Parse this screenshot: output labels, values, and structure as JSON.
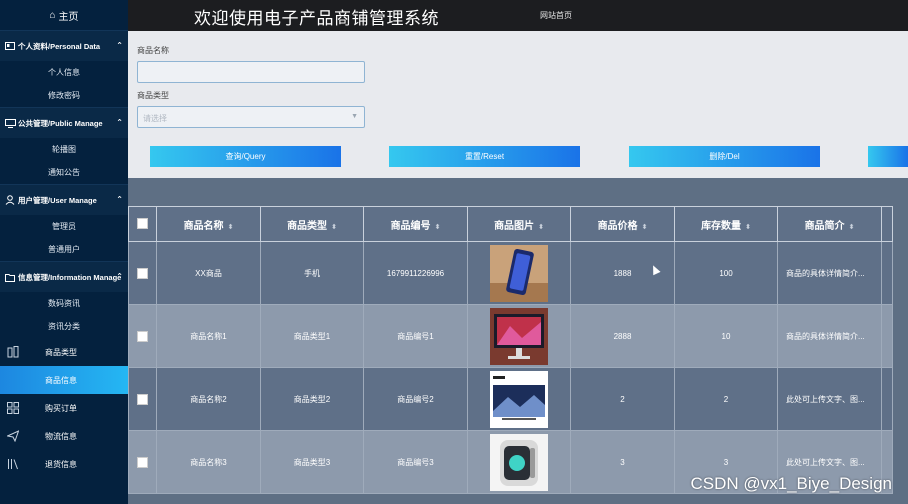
{
  "sidebar": {
    "home": "主页",
    "groups": [
      {
        "label": "个人资料/Personal Data",
        "items": [
          "个人信息",
          "修改密码"
        ]
      },
      {
        "label": "公共管理/Public Manage",
        "items": [
          "轮播图",
          "通知公告"
        ]
      },
      {
        "label": "用户管理/User Manage",
        "items": [
          "管理员",
          "普通用户"
        ]
      },
      {
        "label": "信息管理/Information Manage",
        "items": [
          "数码资讯",
          "资讯分类"
        ]
      }
    ],
    "items": [
      {
        "label": "商品类型",
        "icon": "product-type-icon",
        "active": false
      },
      {
        "label": "商品信息",
        "icon": "",
        "active": true
      },
      {
        "label": "购买订单",
        "icon": "grid-icon",
        "active": false
      },
      {
        "label": "物流信息",
        "icon": "send-icon",
        "active": false
      },
      {
        "label": "退货信息",
        "icon": "books-icon",
        "active": false
      }
    ]
  },
  "topbar": {
    "title": "欢迎使用电子产品商铺管理系统",
    "home_link": "网站首页"
  },
  "search": {
    "name_label": "商品名称",
    "type_label": "商品类型",
    "type_placeholder": "请选择"
  },
  "buttons": {
    "query": "查询/Query",
    "reset": "重置/Reset",
    "delete": "删除/Del"
  },
  "table": {
    "headers": [
      "商品名称",
      "商品类型",
      "商品编号",
      "商品图片",
      "商品价格",
      "库存数量",
      "商品简介"
    ],
    "rows": [
      {
        "name": "XX商品",
        "type": "手机",
        "code": "1679911226996",
        "image": "phone-image",
        "price": "1888",
        "stock": "100",
        "intro": "商品的具体详情简介..."
      },
      {
        "name": "商品名称1",
        "type": "商品类型1",
        "code": "商品编号1",
        "image": "monitor-image",
        "price": "2888",
        "stock": "10",
        "intro": "商品的具体详情简介..."
      },
      {
        "name": "商品名称2",
        "type": "商品类型2",
        "code": "商品编号2",
        "image": "tv-image",
        "price": "2",
        "stock": "2",
        "intro": "此处可上传文字、图..."
      },
      {
        "name": "商品名称3",
        "type": "商品类型3",
        "code": "商品编号3",
        "image": "pc-image",
        "price": "3",
        "stock": "3",
        "intro": "此处可上传文字、图..."
      }
    ]
  },
  "watermark": "CSDN @vx1_Biye_Design"
}
